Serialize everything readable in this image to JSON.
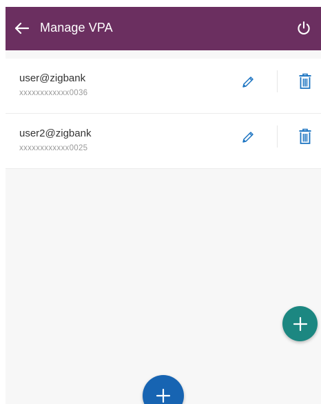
{
  "header": {
    "title": "Manage VPA",
    "back_icon": "arrow-left-icon",
    "power_icon": "power-icon",
    "background": "#6b2f60"
  },
  "vpa_list": [
    {
      "vpa": "user@zigbank",
      "account": "xxxxxxxxxxxx0036",
      "edit_icon": "pencil-icon",
      "delete_icon": "trash-icon"
    },
    {
      "vpa": "user2@zigbank",
      "account": "xxxxxxxxxxxx0025",
      "edit_icon": "pencil-icon",
      "delete_icon": "trash-icon"
    }
  ],
  "fabs": {
    "add_vpa_icon": "plus-icon",
    "add_vpa_color": "#1c8781",
    "bottom_add_icon": "plus-icon",
    "bottom_add_color": "#1764b2"
  },
  "colors": {
    "icon_accent": "#1a73c1",
    "page_background": "#f7f7f7"
  }
}
